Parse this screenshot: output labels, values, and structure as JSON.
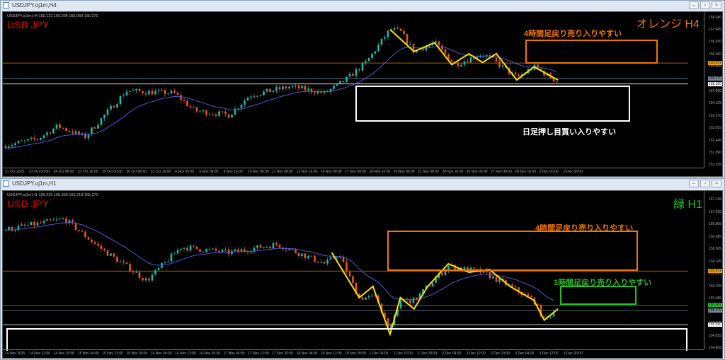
{
  "top": {
    "title": "USDJPY.oj1m,H4",
    "info": "USDJPY.oj1m,H4  155.122 155.306 155.069 155.270",
    "symbol": "USD JPY",
    "tf_label": "オレンジ H4",
    "note_sell": "4時間足戻り売り入りやすい",
    "note_buy": "日足押し目買い入りやすい",
    "prices": [
      "158.040",
      "157.485",
      "156.930",
      "156.360",
      "155.805",
      "154.680",
      "154.125",
      "153.570",
      "153.015",
      "152.445",
      "151.890",
      "151.335"
    ],
    "markers": [
      {
        "text": "155.972",
        "bg": "#f0a000",
        "fg": "#000"
      },
      {
        "text": "155.270",
        "bg": "#778899",
        "fg": "#000"
      },
      {
        "text": "155.020",
        "bg": "#ffffff",
        "fg": "#000"
      }
    ],
    "times": [
      "21 Oct 2025",
      "23 Oct 00:00",
      "24 Oct 08:00",
      "27 Oct 16:00",
      "29 Oct 00:00",
      "30 Oct 08:00",
      "31 Oct 16:00",
      "4 Nov 00:00",
      "5 Nov 08:00",
      "6 Nov 16:00",
      "10 Nov 00:00",
      "11 Nov 08:00",
      "12 Nov 16:00",
      "14 Nov 00:00",
      "17 Nov 08:00",
      "18 Nov 16:00",
      "20 Nov 00:00",
      "21 Nov 08:00",
      "24 Nov 16:00",
      "26 Nov 00:00",
      "27 Nov 08:00",
      "28 Nov 16:00",
      "2 Dec 00:00",
      "3 Dec 08:00"
    ]
  },
  "bottom": {
    "title": "USDJPY.oj1m,H1",
    "info": "USDJPY.oj1m,H1  155.225 155.306 155.218 155.270",
    "symbol": "USD JPY",
    "tf_label": "緑 H1",
    "note_sell4": "4時間足戻り売り入りやすい",
    "note_sell1": "1時間足戻り売り入りやすい",
    "prices": [
      "157.245",
      "157.025",
      "156.805",
      "156.585",
      "156.365",
      "156.145",
      "155.925",
      "155.705",
      "155.485",
      "155.045",
      "154.825",
      "154.605"
    ],
    "markers": [
      {
        "text": "155.972",
        "bg": "#f0a000",
        "fg": "#000"
      },
      {
        "text": "155.367",
        "bg": "#22c022",
        "fg": "#000"
      },
      {
        "text": "155.270",
        "bg": "#778899",
        "fg": "#000"
      },
      {
        "text": "155.020",
        "bg": "#ffffff",
        "fg": "#000"
      }
    ],
    "times": [
      "14 Nov 2025",
      "14 Nov 12:00",
      "14 Nov 20:00",
      "15 Nov 04:00",
      "15 Nov 12:00",
      "15 Nov 20:00",
      "16 Nov 04:00",
      "16 Nov 12:00",
      "16 Nov 20:00",
      "17 Nov 04:00",
      "17 Nov 12:00",
      "17 Nov 20:00",
      "18 Nov 04:00",
      "18 Nov 12:00",
      "18 Nov 20:00",
      "1 Dec 04:00",
      "1 Dec 12:00",
      "1 Dec 20:00",
      "2 Dec 04:00",
      "2 Dec 12:00",
      "2 Dec 20:00",
      "3 Dec 04:00",
      "3 Dec 12:00",
      "3 Dec 20:00"
    ]
  },
  "colors": {
    "bull": "#20b8a8",
    "bear": "#e8552a",
    "ma": "#4a5cd8",
    "zigzag": "#ffe000",
    "orange": "#f07800",
    "green": "#22c022"
  },
  "chart_data": [
    {
      "type": "candlestick",
      "title": "USDJPY H4",
      "ylim": [
        151.335,
        158.04
      ],
      "path": [
        [
          0,
          152.2
        ],
        [
          0.05,
          152.5
        ],
        [
          0.08,
          153.1
        ],
        [
          0.12,
          152.6
        ],
        [
          0.18,
          154.7
        ],
        [
          0.25,
          154.6
        ],
        [
          0.28,
          153.8
        ],
        [
          0.33,
          153.6
        ],
        [
          0.36,
          154.5
        ],
        [
          0.42,
          154.9
        ],
        [
          0.47,
          154.6
        ],
        [
          0.5,
          155.2
        ],
        [
          0.53,
          156.0
        ],
        [
          0.565,
          157.5
        ],
        [
          0.58,
          157.4
        ],
        [
          0.6,
          156.5
        ],
        [
          0.63,
          156.9
        ],
        [
          0.66,
          155.9
        ],
        [
          0.7,
          156.4
        ],
        [
          0.72,
          156.0
        ],
        [
          0.75,
          155.3
        ],
        [
          0.775,
          155.8
        ],
        [
          0.81,
          155.1
        ]
      ],
      "zigzag": [
        [
          0.565,
          157.5
        ],
        [
          0.6,
          156.5
        ],
        [
          0.63,
          156.9
        ],
        [
          0.655,
          155.9
        ],
        [
          0.68,
          156.4
        ],
        [
          0.7,
          156.0
        ],
        [
          0.72,
          156.4
        ],
        [
          0.75,
          155.2
        ],
        [
          0.775,
          155.8
        ],
        [
          0.81,
          155.2
        ]
      ]
    },
    {
      "type": "candlestick",
      "title": "USDJPY H1",
      "ylim": [
        154.605,
        157.245
      ],
      "path": [
        [
          0,
          156.7
        ],
        [
          0.09,
          156.9
        ],
        [
          0.14,
          156.4
        ],
        [
          0.21,
          155.8
        ],
        [
          0.26,
          156.4
        ],
        [
          0.33,
          156.3
        ],
        [
          0.4,
          156.45
        ],
        [
          0.47,
          156.1
        ],
        [
          0.49,
          156.27
        ],
        [
          0.52,
          155.5
        ],
        [
          0.545,
          155.5
        ],
        [
          0.565,
          154.9
        ],
        [
          0.58,
          155.45
        ],
        [
          0.6,
          155.45
        ],
        [
          0.62,
          155.7
        ],
        [
          0.65,
          156.06
        ],
        [
          0.7,
          155.95
        ],
        [
          0.74,
          155.7
        ],
        [
          0.775,
          155.45
        ],
        [
          0.79,
          155.1
        ],
        [
          0.808,
          155.3
        ]
      ],
      "zigzag": [
        [
          0.48,
          156.3
        ],
        [
          0.52,
          155.5
        ],
        [
          0.54,
          155.7
        ],
        [
          0.565,
          154.85
        ],
        [
          0.58,
          155.5
        ],
        [
          0.6,
          155.3
        ],
        [
          0.62,
          155.7
        ],
        [
          0.65,
          156.1
        ],
        [
          0.68,
          155.95
        ],
        [
          0.71,
          156.0
        ],
        [
          0.74,
          155.7
        ],
        [
          0.775,
          155.45
        ],
        [
          0.79,
          155.1
        ],
        [
          0.81,
          155.3
        ]
      ]
    }
  ]
}
